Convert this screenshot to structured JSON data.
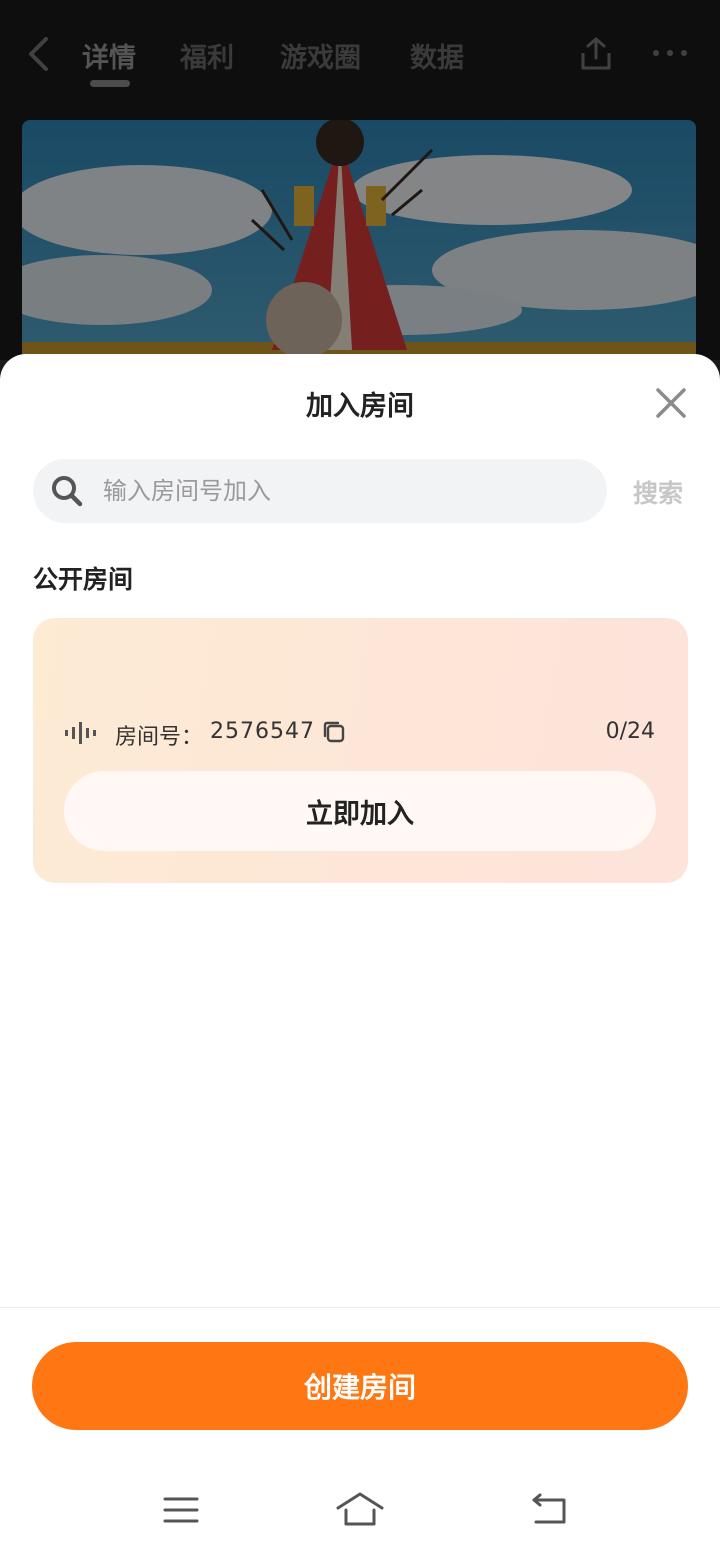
{
  "topbar": {
    "tabs": [
      {
        "label": "详情",
        "active": true
      },
      {
        "label": "福利",
        "active": false
      },
      {
        "label": "游戏圈",
        "active": false
      },
      {
        "label": "数据",
        "active": false
      }
    ],
    "icons": [
      "back-icon",
      "share-icon",
      "more-icon"
    ]
  },
  "sheet": {
    "title": "加入房间",
    "search": {
      "placeholder": "输入房间号加入",
      "value": "",
      "button_label": "搜索"
    },
    "section_title": "公开房间",
    "rooms": [
      {
        "label": "房间号：",
        "number": "2576547",
        "count": "0/24",
        "join_label": "立即加入"
      }
    ],
    "create_label": "创建房间"
  },
  "colors": {
    "accent": "#fe7712",
    "card_gradient_start": "#fdebd3",
    "card_gradient_end": "#fde3da",
    "search_bg": "#f2f3f5"
  }
}
